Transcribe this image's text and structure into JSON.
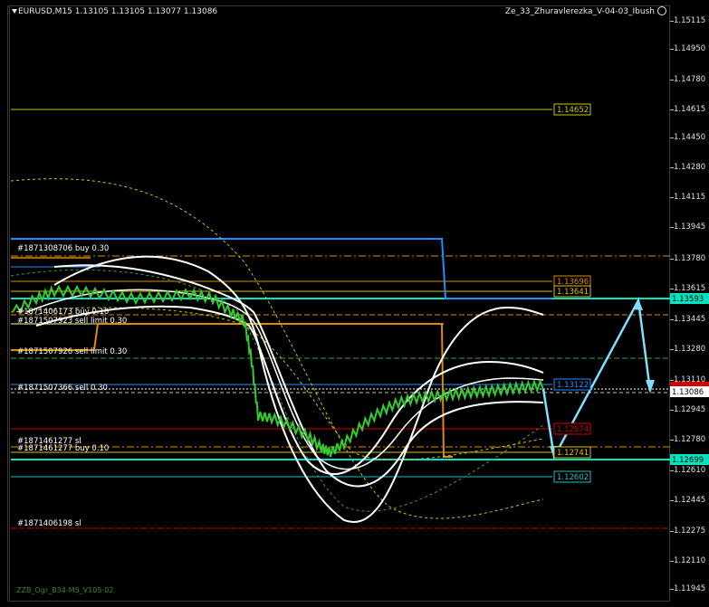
{
  "header": {
    "symbol_title": "EURUSD,M15  1.13105 1.13105 1.13077 1.13086",
    "ea_name": "Ze_33_Zhuravlerezka_V-04-03_Ibush"
  },
  "price_axis": {
    "ticks": [
      "1.15115",
      "1.14950",
      "1.14780",
      "1.14615",
      "1.14450",
      "1.14280",
      "1.14115",
      "1.13945",
      "1.13780",
      "1.13615",
      "1.13445",
      "1.13280",
      "1.13110",
      "1.12945",
      "1.12780",
      "1.12610",
      "1.12445",
      "1.12275",
      "1.12110",
      "1.11945"
    ],
    "current_price": "1.13086",
    "marker_top": "1.13593",
    "marker_bottom": "1.12699"
  },
  "levels": [
    {
      "name": "level-1.14652",
      "text": "1.14652",
      "color": "#c8c800"
    },
    {
      "name": "level-1.13696",
      "text": "1.13696",
      "color": "#e08a00"
    },
    {
      "name": "level-1.13641",
      "text": "1.13641",
      "color": "#e0c000"
    },
    {
      "name": "level-1.13122",
      "text": "1.13122",
      "color": "#1e90ff"
    },
    {
      "name": "level-1.12874",
      "text": "1.12874",
      "color": "#d00000"
    },
    {
      "name": "level-1.12741",
      "text": "1.12741",
      "color": "#e0c000"
    },
    {
      "name": "level-1.12602",
      "text": "1.12602",
      "color": "#20c0c0"
    }
  ],
  "orders": [
    {
      "text": "#1871308706 buy 0.30"
    },
    {
      "text": "#1871406173 buy 0.10"
    },
    {
      "text": "#1871507923 sell limit 0.30"
    },
    {
      "text": "#1871507926 sell limit 0.30"
    },
    {
      "text": "#1871507366 sell 0.30"
    },
    {
      "text": "#1871461277 sl"
    },
    {
      "text": "#1871461277 buy 0.10"
    },
    {
      "text": "#1871406198 sl"
    }
  ],
  "footer": {
    "text": "ZZB_Ogr_B34-M5_V105-02"
  },
  "colors": {
    "background": "#000000",
    "candles": "#32cd32",
    "bands": "#ffffff",
    "cyan": "#00e5c0",
    "arrow": "#7fdfff"
  }
}
